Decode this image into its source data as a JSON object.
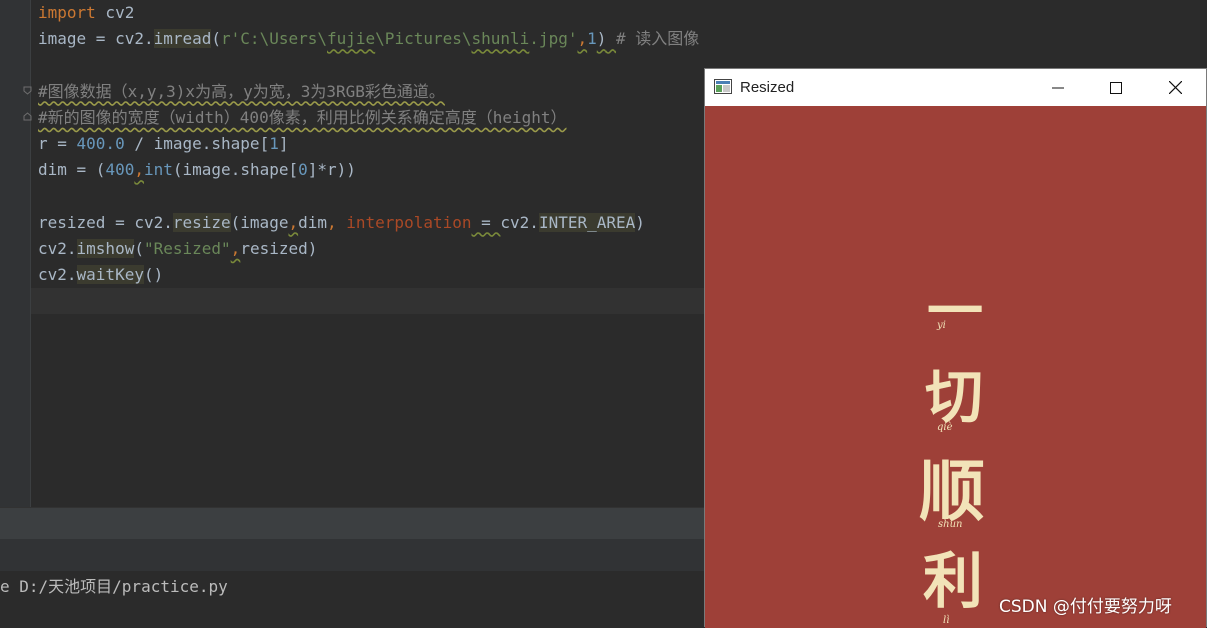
{
  "editor": {
    "lines": [
      {
        "parts": [
          {
            "t": "import",
            "c": "kw"
          },
          {
            "t": " cv2"
          }
        ]
      },
      {
        "parts": [
          {
            "t": "image = cv2."
          },
          {
            "t": "imread",
            "c": "fn"
          },
          {
            "t": "("
          },
          {
            "t": "r'C:\\Users\\",
            "c": "str"
          },
          {
            "t": "fujie",
            "c": "str wave"
          },
          {
            "t": "\\Pictures\\",
            "c": "str"
          },
          {
            "t": "shunli",
            "c": "str wave"
          },
          {
            "t": ".jpg'",
            "c": "str"
          },
          {
            "t": ",",
            "c": "kw wave"
          },
          {
            "t": "1",
            "c": "num"
          },
          {
            "t": ") ",
            "c": "wave"
          },
          {
            "t": "# 读入图像",
            "c": "cmt"
          }
        ]
      },
      {
        "parts": [
          {
            "t": ""
          }
        ]
      },
      {
        "parts": [
          {
            "t": "#图像数据（x,y,3)x为高，y为宽，3为3RGB彩色通道。",
            "c": "cmt cmt-wave"
          }
        ]
      },
      {
        "parts": [
          {
            "t": "#新的图像的宽度（width）400像素，利用比例关系确定高度（height）",
            "c": "cmt cmt-wave"
          }
        ]
      },
      {
        "parts": [
          {
            "t": "r = "
          },
          {
            "t": "400.0",
            "c": "num"
          },
          {
            "t": " / image.shape["
          },
          {
            "t": "1",
            "c": "num"
          },
          {
            "t": "]"
          }
        ]
      },
      {
        "parts": [
          {
            "t": "dim = ("
          },
          {
            "t": "400",
            "c": "num"
          },
          {
            "t": ",",
            "c": "kw wave"
          },
          {
            "t": "int",
            "c": "num"
          },
          {
            "t": "(image.shape["
          },
          {
            "t": "0",
            "c": "num"
          },
          {
            "t": "]*r))"
          }
        ]
      },
      {
        "parts": [
          {
            "t": ""
          }
        ]
      },
      {
        "parts": [
          {
            "t": "resized = cv2."
          },
          {
            "t": "resize",
            "c": "fn"
          },
          {
            "t": "(image"
          },
          {
            "t": ",",
            "c": "kw wave"
          },
          {
            "t": "dim"
          },
          {
            "t": ", ",
            "c": "kw"
          },
          {
            "t": "interpolation",
            "c": "param"
          },
          {
            "t": " = ",
            "c": "wave"
          },
          {
            "t": "cv2."
          },
          {
            "t": "INTER_AREA",
            "c": "fn"
          },
          {
            "t": ")"
          }
        ]
      },
      {
        "parts": [
          {
            "t": "cv2."
          },
          {
            "t": "imshow",
            "c": "fn"
          },
          {
            "t": "("
          },
          {
            "t": "\"Resized\"",
            "c": "str"
          },
          {
            "t": ",",
            "c": "kw wave"
          },
          {
            "t": "resized)"
          }
        ]
      },
      {
        "parts": [
          {
            "t": "cv2."
          },
          {
            "t": "waitKey",
            "c": "fn"
          },
          {
            "t": "()"
          }
        ]
      }
    ]
  },
  "console": {
    "run_line": "e D:/天池项目/practice.py"
  },
  "window": {
    "title": "Resized",
    "image_chars": [
      "一",
      "切",
      "顺",
      "利"
    ],
    "pinyin": [
      "yi",
      "qiè",
      "shùn",
      "lì"
    ],
    "background_color": "#9e4038",
    "text_color": "#f2e3b8"
  },
  "watermark": "CSDN @付付要努力呀"
}
